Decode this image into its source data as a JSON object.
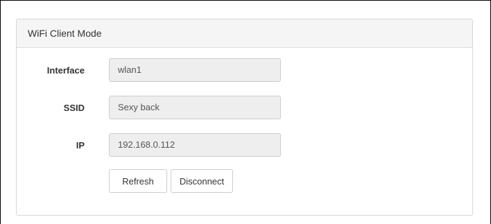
{
  "panel": {
    "title": "WiFi Client Mode"
  },
  "fields": [
    {
      "label": "Interface",
      "value": "wlan1"
    },
    {
      "label": "SSID",
      "value": "Sexy back"
    },
    {
      "label": "IP",
      "value": "192.168.0.112"
    }
  ],
  "buttons": {
    "refresh_label": "Refresh",
    "disconnect_label": "Disconnect"
  }
}
